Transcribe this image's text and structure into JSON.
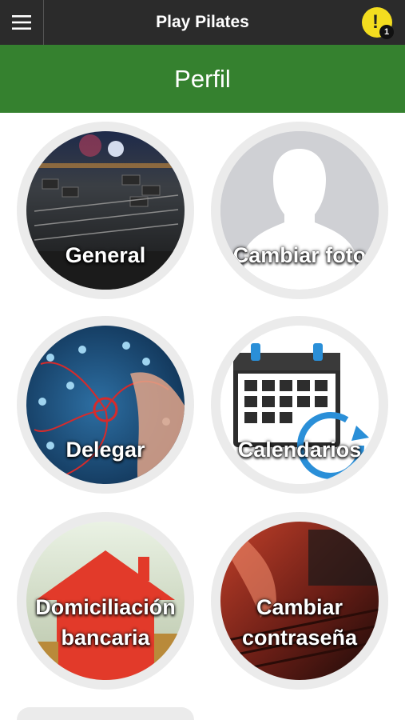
{
  "app": {
    "title": "Play Pilates"
  },
  "notification": {
    "count": "1",
    "icon": "alert-icon",
    "color": "#f3dd1f"
  },
  "header": {
    "title": "Perfil",
    "color": "#35812f"
  },
  "tiles": [
    {
      "label": "General",
      "icon": "mixer-photo"
    },
    {
      "label": "Cambiar foto",
      "icon": "person-silhouette"
    },
    {
      "label": "Delegar",
      "icon": "network-photo"
    },
    {
      "label": "Calendarios",
      "icon": "calendar-sync-icon"
    },
    {
      "label_line1": "Domiciliación",
      "label_line2": "bancaria",
      "icon": "house-photo"
    },
    {
      "label_line1": "Cambiar",
      "label_line2": "contraseña",
      "icon": "keyboard-photo"
    }
  ]
}
